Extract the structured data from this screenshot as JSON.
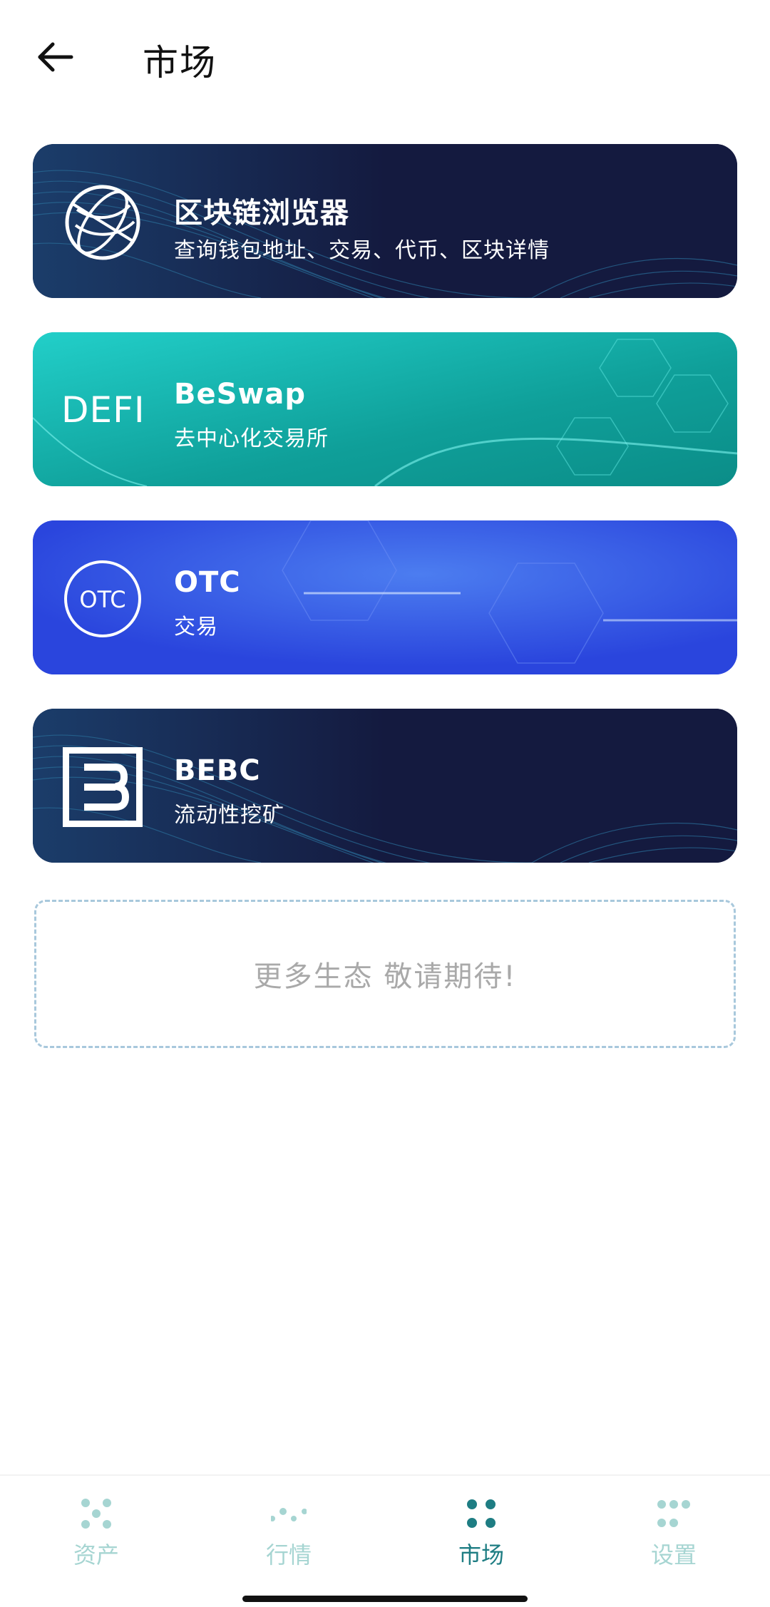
{
  "header": {
    "back_icon": "arrow-left-icon",
    "title": "市场"
  },
  "cards": [
    {
      "id": "explorer",
      "icon": "globe-icon",
      "title": "区块链浏览器",
      "subtitle": "查询钱包地址、交易、代币、区块详情"
    },
    {
      "id": "beswap",
      "icon": "defi-logo",
      "icon_text": "DEFI",
      "title": "BeSwap",
      "subtitle": "去中心化交易所"
    },
    {
      "id": "otc",
      "icon": "otc-badge-icon",
      "icon_text": "OTC",
      "title": "OTC",
      "subtitle": "交易"
    },
    {
      "id": "bebc",
      "icon": "bebc-logo-icon",
      "title": "BEBC",
      "subtitle": "流动性挖矿"
    }
  ],
  "more": {
    "text": "更多生态 敬请期待!"
  },
  "bottom_nav": {
    "items": [
      {
        "label": "资产",
        "icon": "assets-dots-icon",
        "active": false
      },
      {
        "label": "行情",
        "icon": "market-dots-icon",
        "active": false
      },
      {
        "label": "市场",
        "icon": "market-grid-icon",
        "active": true
      },
      {
        "label": "设置",
        "icon": "settings-dots-icon",
        "active": false
      }
    ]
  },
  "colors": {
    "explorer_bg": "#141a3f",
    "beswap_bg": "#12b3ad",
    "otc_bg": "#2a45dd",
    "nav_active": "#1e7d83",
    "nav_inactive": "#a6d5d2",
    "more_text": "#a9a9a9"
  }
}
